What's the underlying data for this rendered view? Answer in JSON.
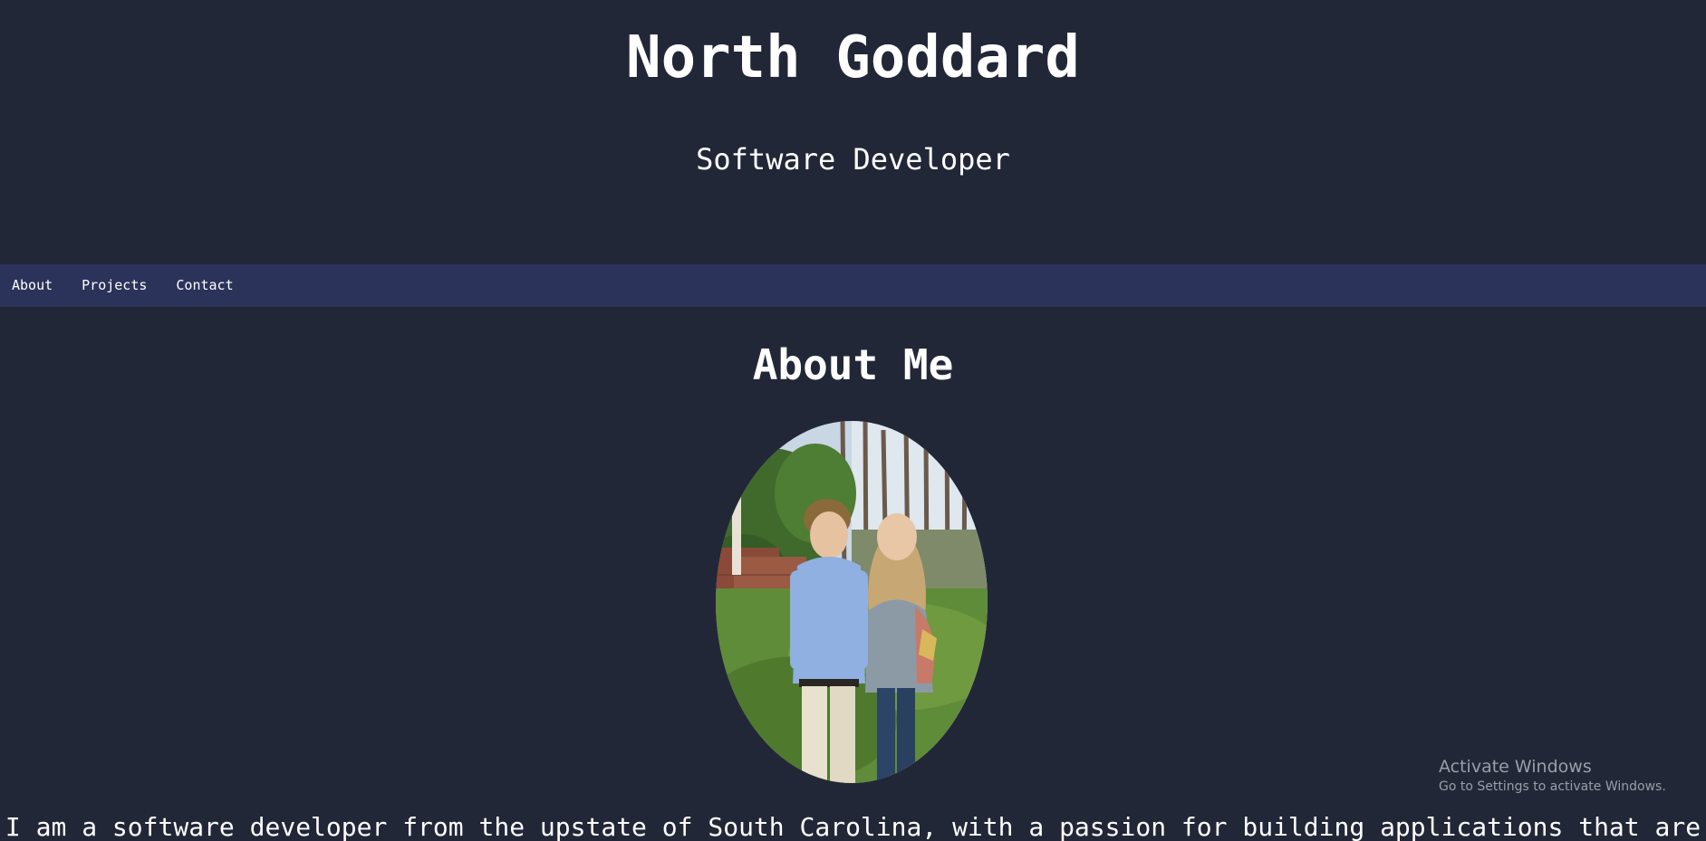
{
  "header": {
    "title": "North Goddard",
    "subtitle": "Software Developer"
  },
  "nav": {
    "items": [
      {
        "label": "About"
      },
      {
        "label": "Projects"
      },
      {
        "label": "Contact"
      }
    ]
  },
  "about": {
    "heading": "About Me",
    "bio": "I am a software developer from the upstate of South Carolina, with a passion for building applications that are"
  },
  "watermark": {
    "title": "Activate Windows",
    "subtitle": "Go to Settings to activate Windows."
  },
  "colors": {
    "background": "#222738",
    "navbar": "#2b335a",
    "text": "#ffffff",
    "watermark": "#9a9ea8"
  }
}
